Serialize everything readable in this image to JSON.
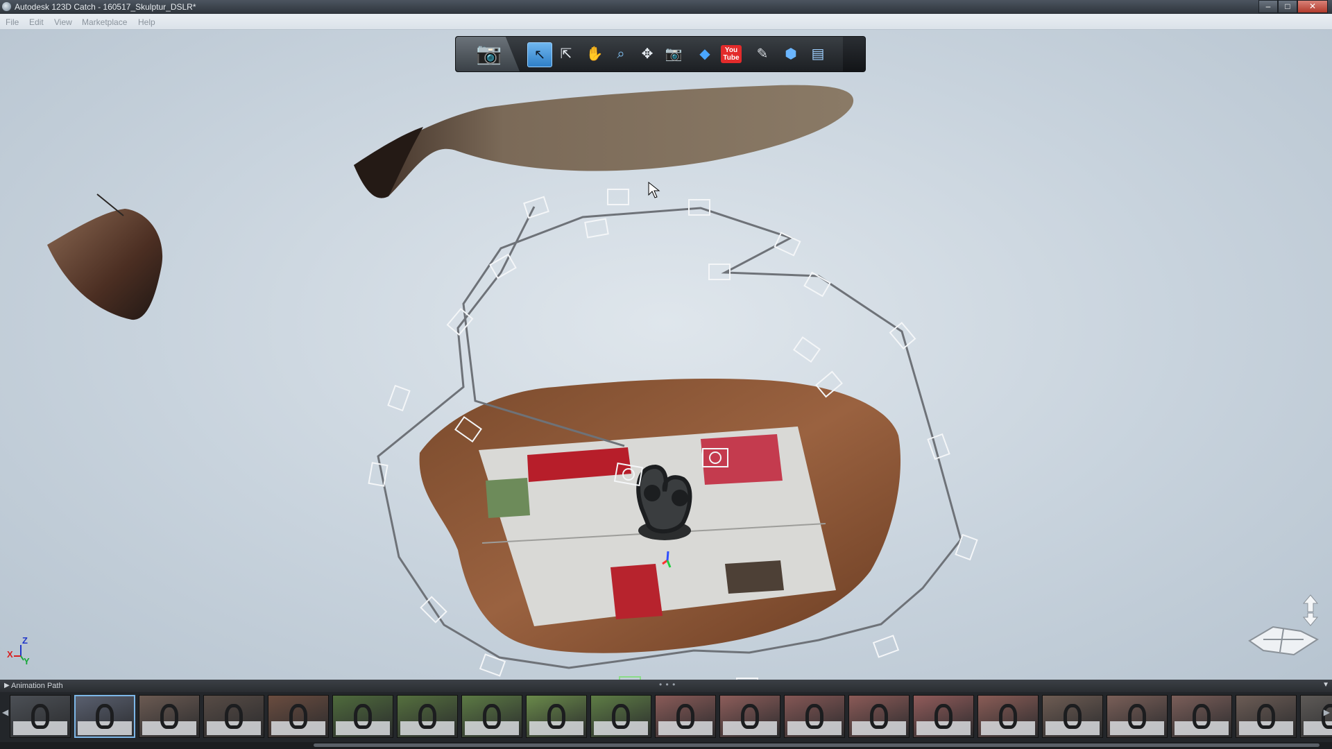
{
  "window": {
    "title": "Autodesk 123D Catch - 160517_Skulptur_DSLR*",
    "controls": {
      "minimize": "–",
      "maximize": "□",
      "close": "✕"
    }
  },
  "menu": {
    "items": [
      "File",
      "Edit",
      "View",
      "Marketplace",
      "Help"
    ]
  },
  "toolbar": {
    "camera_icon": "camera-icon",
    "tools": [
      {
        "name": "select-tool",
        "glyph": "↖",
        "active": true
      },
      {
        "name": "lasso-select-tool",
        "glyph": "⇱",
        "active": false
      },
      {
        "name": "pan-tool",
        "glyph": "✋",
        "active": false
      },
      {
        "name": "zoom-window-tool",
        "glyph": "⌕",
        "active": false
      },
      {
        "name": "orbit-tool",
        "glyph": "✥",
        "active": false
      },
      {
        "name": "camera-view-tool",
        "glyph": "📷",
        "active": false
      },
      {
        "name": "reference-scale-tool",
        "glyph": "◆",
        "active": false
      },
      {
        "name": "youtube-export-tool",
        "glyph": "You\nTube",
        "active": false
      },
      {
        "name": "marker-pen-tool",
        "glyph": "✎",
        "active": false
      },
      {
        "name": "mesh-quality-tool",
        "glyph": "⬢",
        "active": false
      },
      {
        "name": "export-tool",
        "glyph": "▤",
        "active": false
      }
    ],
    "colors": {
      "active": "#2f7fc7",
      "youtube": "#e32b2b"
    }
  },
  "axis_indicator": {
    "z": "Z",
    "x": "X",
    "y": "Y"
  },
  "animation_panel": {
    "label": "Animation Path",
    "grip": "• • •",
    "selected_index": 1,
    "thumbnails": [
      {
        "tone": "#4c5056"
      },
      {
        "tone": "#5a6070"
      },
      {
        "tone": "#6b5a52"
      },
      {
        "tone": "#574b45"
      },
      {
        "tone": "#6a4c3f"
      },
      {
        "tone": "#4f6b3c"
      },
      {
        "tone": "#55703e"
      },
      {
        "tone": "#5c7a44"
      },
      {
        "tone": "#6a8a4a"
      },
      {
        "tone": "#5e7d45"
      },
      {
        "tone": "#8a5b58"
      },
      {
        "tone": "#8d5d5a"
      },
      {
        "tone": "#855755"
      },
      {
        "tone": "#8b5a57"
      },
      {
        "tone": "#915b5a"
      },
      {
        "tone": "#8a5c56"
      },
      {
        "tone": "#6e5c53"
      },
      {
        "tone": "#7a5f58"
      },
      {
        "tone": "#7b5e59"
      },
      {
        "tone": "#6c5c55"
      },
      {
        "tone": "#5e5a57"
      }
    ]
  }
}
